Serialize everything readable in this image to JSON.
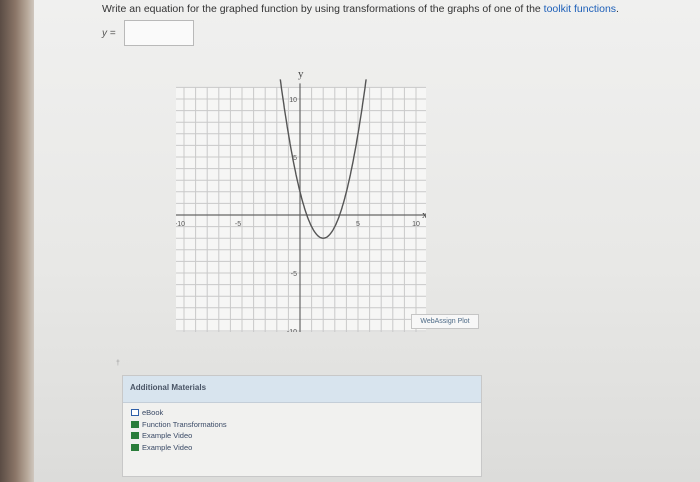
{
  "question": {
    "prefix": "Write an equation for the graphed function by using transformations of the graphs of one of the ",
    "link": "toolkit functions",
    "suffix": "."
  },
  "answer": {
    "label": "y =",
    "value": ""
  },
  "graph": {
    "y_axis_label": "y",
    "x_axis_label": "x",
    "x_ticks": [
      "-10",
      "-5",
      "5",
      "10"
    ],
    "y_ticks": [
      "10",
      "5",
      "-5",
      "-10"
    ]
  },
  "chart_data": {
    "type": "line",
    "x_axis_label": "x",
    "y_axis_label": "y",
    "xlim": [
      -11,
      11
    ],
    "ylim": [
      -11,
      11
    ],
    "grid": true,
    "series": [
      {
        "x": [
          -3,
          -2,
          -1,
          0,
          1,
          2,
          3,
          4,
          5,
          6,
          7
        ],
        "y": [
          23,
          14,
          7,
          2,
          -1,
          -2,
          -1,
          2,
          7,
          14,
          23
        ]
      }
    ]
  },
  "plot_badge": "WebAssign Plot",
  "small_mark": "†",
  "materials": {
    "header": "Additional Materials",
    "items": [
      {
        "label": "eBook",
        "icon": "book-icon"
      },
      {
        "label": "Function Transformations",
        "icon": "document-icon"
      },
      {
        "label": "Example Video",
        "icon": "document-icon"
      },
      {
        "label": "Example Video",
        "icon": "document-icon"
      }
    ]
  }
}
